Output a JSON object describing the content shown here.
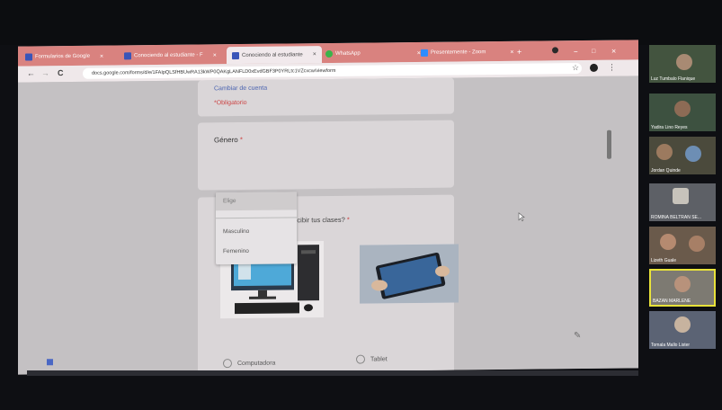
{
  "browser": {
    "tabs": [
      {
        "label": "Formularios de Google"
      },
      {
        "label": "Conociendo al estudiante - F"
      },
      {
        "label": "Conociendo al estudiante"
      },
      {
        "label": "WhatsApp"
      },
      {
        "label": "Presentemente - Zoom"
      }
    ],
    "url": "docs.google.com/forms/d/e/1FAIpQLSfHBUwRA13kWP0QAKgLANFLD0xEvdGBF3P0YRLtc1VZcxcw/viewform",
    "nav_back": "←",
    "nav_forward": "→",
    "reload": "C",
    "new_tab": "+",
    "win_min": "−",
    "win_max": "□",
    "win_close": "×",
    "star": "☆",
    "menu": "⋮"
  },
  "form": {
    "switch_account": "Cambiar de cuenta",
    "required_note": "*Obligatorio",
    "gender_question": "Género",
    "required_mark": "*",
    "dropdown_placeholder": "Elige",
    "dropdown_options": [
      "Masculino",
      "Femenino"
    ],
    "device_question_fragment": "ra recibir tus clases?",
    "device_options": [
      {
        "label": "Computadora"
      },
      {
        "label": "Tablet"
      }
    ]
  },
  "zoom": {
    "participants": [
      {
        "name": "Luz Tumbalo Flanique"
      },
      {
        "name": "Yadira Lino Reyes"
      },
      {
        "name": "Jordan Quinde"
      },
      {
        "name": "ROMINA BELTRAN SE..."
      },
      {
        "name": "Lizeth Guale"
      },
      {
        "name": "BAZAN MARLENE"
      },
      {
        "name": "Tomala Mallo Lister"
      }
    ],
    "highlight_color": "#e8e23a"
  }
}
